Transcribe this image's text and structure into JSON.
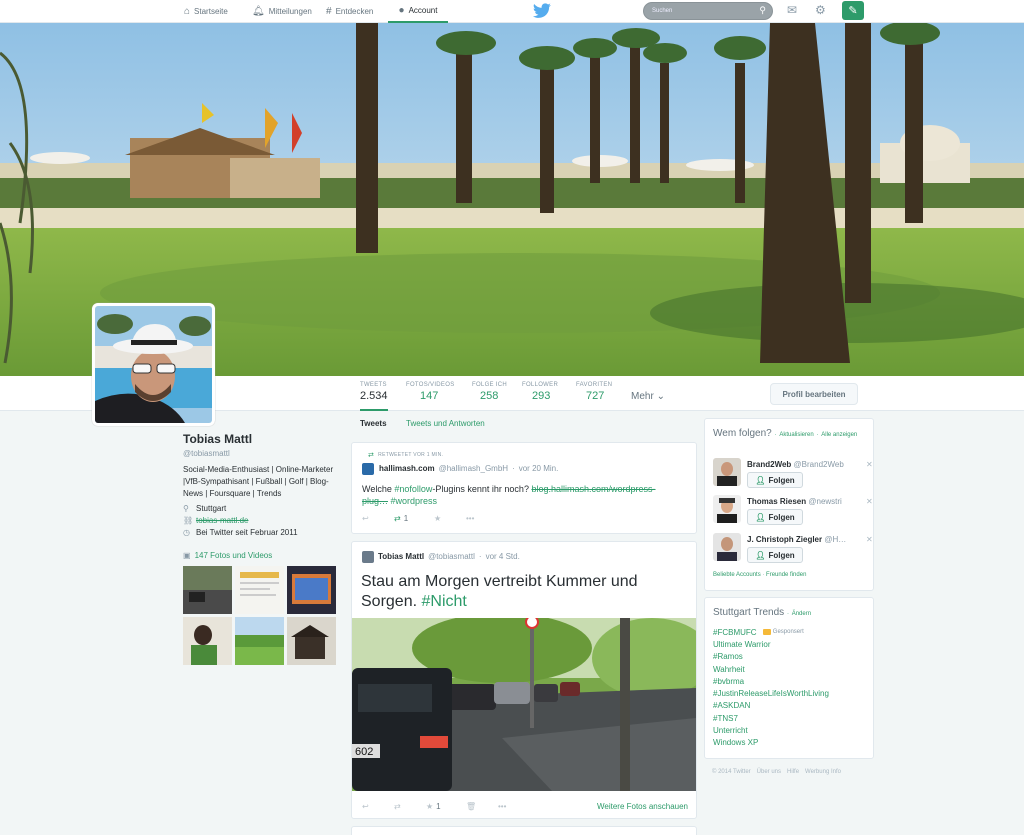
{
  "topnav": {
    "items": [
      {
        "icon": "home-icon",
        "label": "Startseite"
      },
      {
        "icon": "bell-icon",
        "label": "Mitteilungen"
      },
      {
        "icon": "hash-icon",
        "label": "Entdecken"
      },
      {
        "icon": "person-icon",
        "label": "Account"
      }
    ],
    "search_placeholder": "Suchen"
  },
  "profile": {
    "name": "Tobias Mattl",
    "handle": "@tobiasmattl",
    "bio": "Social-Media-Enthusiast | Online-Marketer |VfB-Sympathisant | Fußball | Golf | Blog-News | Foursquare | Trends",
    "location": "Stuttgart",
    "website": "tobias-mattl.de",
    "joined": "Bei Twitter seit Februar 2011",
    "photos_link": "147 Fotos und Videos"
  },
  "stats": [
    {
      "label": "TWEETS",
      "value": "2.534"
    },
    {
      "label": "FOTOS/VIDEOS",
      "value": "147"
    },
    {
      "label": "FOLGE ICH",
      "value": "258"
    },
    {
      "label": "FOLLOWER",
      "value": "293"
    },
    {
      "label": "FAVORITEN",
      "value": "727"
    }
  ],
  "more_label": "Mehr",
  "edit_profile_label": "Profil bearbeiten",
  "timeline": {
    "tab_tweets": "Tweets",
    "tab_replies": "Tweets und Antworten",
    "tweet1": {
      "rt_note": "RETWEETET VOR 1 MIN.",
      "name": "hallimash.com",
      "handle": "@hallimash_GmbH",
      "time": "vor 20 Min.",
      "text_pre": "Welche ",
      "hashtag1": "#nofollow",
      "text_mid": "-Plugins kennt ihr noch? ",
      "link1": "blog.hallimash.com/wordpress-",
      "link2": "plug…",
      "hashtag2": "#wordpress",
      "retweets": "1"
    },
    "tweet2": {
      "name": "Tobias Mattl",
      "handle": "@tobiasmattl",
      "time": "vor 4 Std.",
      "text": "Stau am Morgen vertreibt Kummer und Sorgen. ",
      "hashtag": "#Nicht",
      "favorites": "1",
      "more_photos": "Weitere Fotos anschauen",
      "plate": "602"
    }
  },
  "who_to_follow": {
    "title": "Wem folgen?",
    "refresh": "Aktualisieren",
    "show_all": "Alle anzeigen",
    "follow_label": "Folgen",
    "suggestions": [
      {
        "name": "Brand2Web",
        "handle": "@Brand2Web"
      },
      {
        "name": "Thomas Riesen",
        "handle": "@newstri"
      },
      {
        "name": "J. Christoph Ziegler",
        "handle": "@H…"
      }
    ],
    "footer_popular": "Beliebte Accounts",
    "footer_find": "Freunde finden"
  },
  "trends": {
    "title": "Stuttgart Trends",
    "change": "Ändern",
    "promoted_label": "Gesponsert",
    "items": [
      "#FCBMUFC",
      "Ultimate Warrior",
      "#Ramos",
      "Wahrheit",
      "#bvbrma",
      "#JustinReleaseLifeIsWorthLiving",
      "#ASKDAN",
      "#TNS7",
      "Unterricht",
      "Windows XP"
    ]
  },
  "footer": [
    "© 2014 Twitter",
    "Über uns",
    "Hilfe",
    "Werbung Info"
  ],
  "colors": {
    "accent": "#2d9b6a",
    "bird": "#55acee",
    "background": "#f2f6f6"
  }
}
